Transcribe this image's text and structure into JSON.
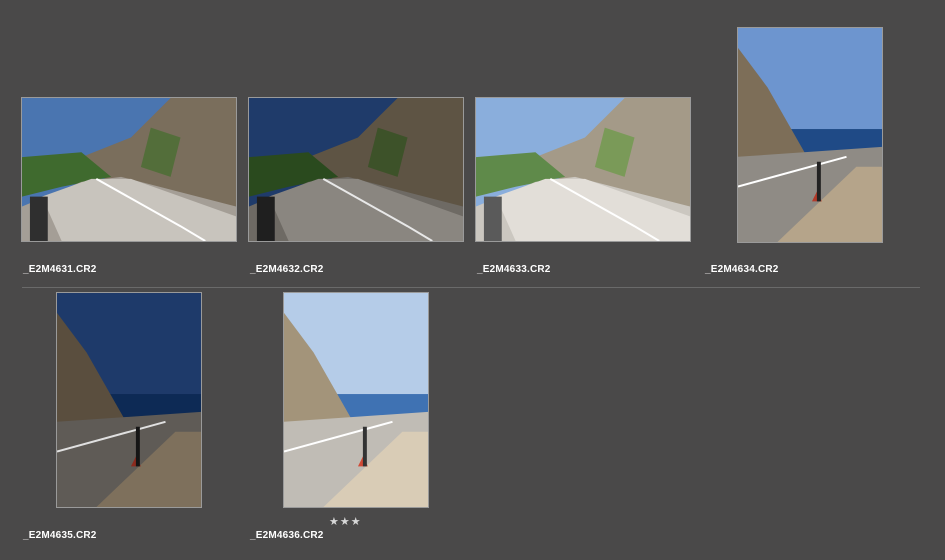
{
  "photos": [
    {
      "filename": "_E2M4631.CR2",
      "orientation": "landscape",
      "exposure": "normal"
    },
    {
      "filename": "_E2M4632.CR2",
      "orientation": "landscape",
      "exposure": "dark"
    },
    {
      "filename": "_E2M4633.CR2",
      "orientation": "landscape",
      "exposure": "bright"
    },
    {
      "filename": "_E2M4634.CR2",
      "orientation": "portrait",
      "exposure": "normal"
    },
    {
      "filename": "_E2M4635.CR2",
      "orientation": "portrait",
      "exposure": "dark"
    },
    {
      "filename": "_E2M4636.CR2",
      "orientation": "portrait",
      "exposure": "bright",
      "rating_display": "★★★",
      "rating": 3
    }
  ]
}
